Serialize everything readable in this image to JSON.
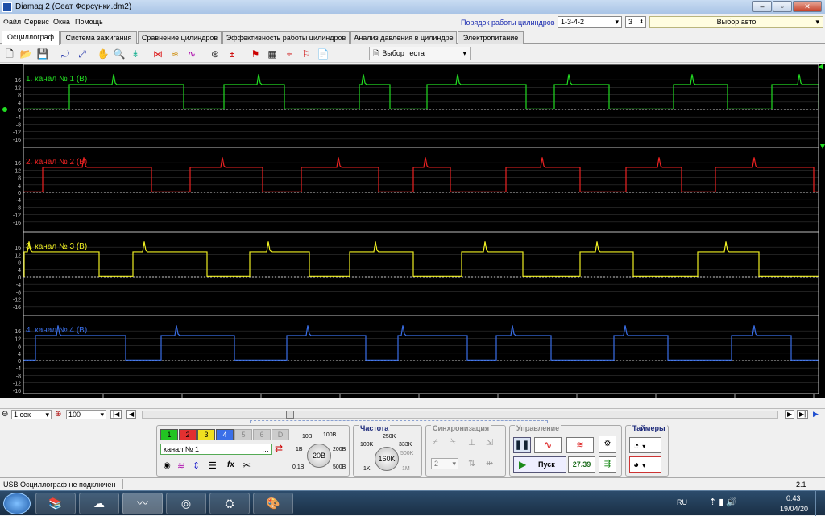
{
  "window": {
    "title": "Diamag 2 (Сеат Форсунки.dm2)"
  },
  "menu": {
    "items": [
      "Файл",
      "Сервис",
      "Окна",
      "Помощь"
    ]
  },
  "header": {
    "cyl_order_label": "Порядок работы цилиндров",
    "cyl_order_value": "1-3-4-2",
    "cyl_count": "3",
    "auto_select": "Выбор авто"
  },
  "tabs": [
    "Осциллограф",
    "Система зажигания",
    "Сравнение цилиндров",
    "Эффективность работы цилиндров",
    "Анализ давления в цилиндре",
    "Электропитание"
  ],
  "toolbar": {
    "test_select": "Выбор теста"
  },
  "channels": [
    {
      "label": "1. канал № 1 (В)",
      "color": "#22dd22"
    },
    {
      "label": "2. канал № 2 (В)",
      "color": "#ee2222"
    },
    {
      "label": "3. канал № 3 (В)",
      "color": "#eeee22"
    },
    {
      "label": "4. канал № 4 (В)",
      "color": "#3a6fe8"
    }
  ],
  "y_ticks": [
    "16",
    "12",
    "8",
    "4",
    "0",
    "-4",
    "-8",
    "-12",
    "-16"
  ],
  "x_ticks": [
    "6.35589",
    "6.45589",
    "6.55589",
    "6.65589",
    "6.75589",
    "6.85589",
    "6.95589",
    "7.05589",
    "7.15589",
    "7.25589"
  ],
  "timebar": {
    "scale": "1 сек",
    "zoom": "100"
  },
  "panel": {
    "channel_buttons": [
      "1",
      "2",
      "3",
      "4",
      "5",
      "6",
      "D"
    ],
    "channel_name": "канал № 1",
    "volt_knob": "20В",
    "volt_labels": [
      "10В",
      "100В",
      "1В",
      "200В",
      "0.1В",
      "500В"
    ],
    "freq_title": "Частота",
    "freq_knob": "160K",
    "freq_labels": [
      "250K",
      "100K",
      "333K",
      "500K",
      "1K",
      "1M"
    ],
    "sync_title": "Синхронизация",
    "sync_value": "2",
    "control_title": "Управление",
    "start_label": "Пуск",
    "counter": "27.39",
    "timers_title": "Таймеры"
  },
  "status": {
    "text": "USB Осциллограф не подключен",
    "version": "2.1"
  },
  "taskbar": {
    "lang": "RU",
    "time": "0:43",
    "date": "19/04/20"
  }
}
